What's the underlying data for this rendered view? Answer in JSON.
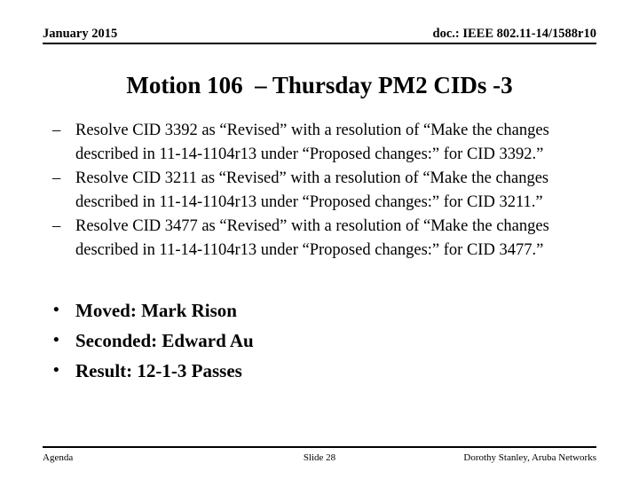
{
  "header": {
    "left": "January 2015",
    "right": "doc.: IEEE 802.11-14/1588r10"
  },
  "title": "Motion 106  – Thursday PM2 CIDs -3",
  "body": {
    "resolutions": [
      {
        "marker": "–",
        "text": "Resolve CID 3392 as “Revised” with a resolution of “Make the changes described in 11-14-1104r13  under “Proposed changes:” for CID 3392.”"
      },
      {
        "marker": "–",
        "text": "Resolve CID 3211 as “Revised” with a resolution of “Make the changes described in 11-14-1104r13  under “Proposed changes:” for CID 3211.”"
      },
      {
        "marker": "–",
        "text": "Resolve CID 3477 as “Revised” with a resolution of “Make the changes described in 11-14-1104r13  under “Proposed changes:” for CID 3477.”"
      }
    ],
    "vote": [
      {
        "marker": "•",
        "text": "Moved: Mark Rison"
      },
      {
        "marker": "•",
        "text": "Seconded: Edward Au"
      },
      {
        "marker": "•",
        "text": "Result: 12-1-3 Passes"
      }
    ]
  },
  "footer": {
    "left": "Agenda",
    "center": "Slide 28",
    "right": "Dorothy Stanley, Aruba Networks"
  },
  "colors": {
    "text": "#000000",
    "background": "#ffffff",
    "rule": "#000000"
  }
}
